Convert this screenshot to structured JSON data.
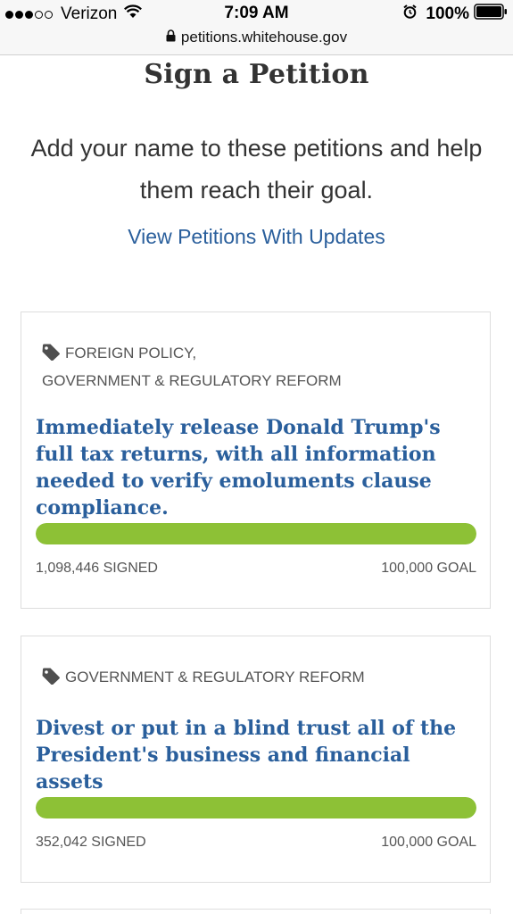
{
  "status_bar": {
    "carrier": "Verizon",
    "time": "7:09 AM",
    "battery": "100%",
    "signal_dots_filled": 3,
    "signal_dots_total": 5
  },
  "browser": {
    "url": "petitions.whitehouse.gov"
  },
  "page": {
    "title": "Sign a Petition",
    "intro": "Add your name to these petitions and help them reach their goal.",
    "view_updates_link": "View Petitions With Updates"
  },
  "colors": {
    "link": "#2a5f9c",
    "progress": "#8dc136"
  },
  "petitions": [
    {
      "tags_line1": "FOREIGN POLICY,",
      "tags_line2": "GOVERNMENT & REGULATORY REFORM",
      "title": "Immediately release Donald Trump's full tax returns, with all information needed to verify emoluments clause compliance.",
      "signed": "1,098,446 SIGNED",
      "goal": "100,000 GOAL",
      "progress": 1.0
    },
    {
      "tags_line1": "GOVERNMENT & REGULATORY REFORM",
      "title": "Divest or put in a blind trust all of the President's business and financial assets",
      "signed": "352,042 SIGNED",
      "goal": "100,000 GOAL",
      "progress": 1.0
    }
  ]
}
